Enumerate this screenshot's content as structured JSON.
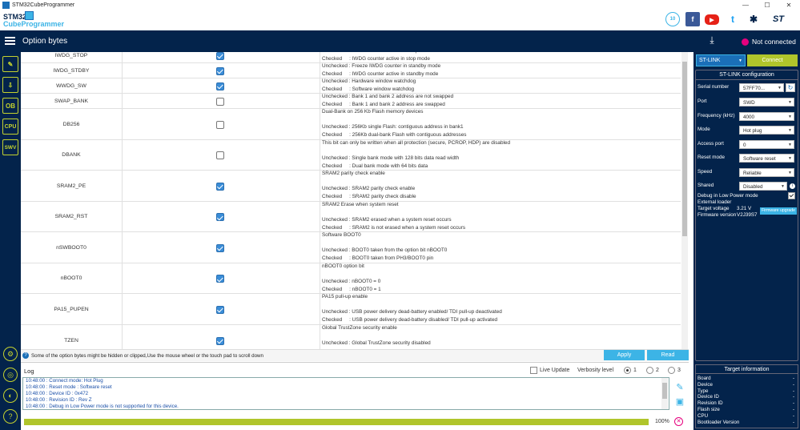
{
  "window": {
    "title": "STM32CubeProgrammer",
    "controls": [
      "—",
      "☐",
      "✕"
    ]
  },
  "logo": {
    "line1": "STM32",
    "line2": "CubeProgrammer"
  },
  "social": [
    "10",
    "f",
    "▶",
    "t",
    "✱",
    "ST"
  ],
  "header": {
    "title": "Option bytes",
    "status": "Not connected"
  },
  "sidebar": {
    "buttons": [
      "✎",
      "⇩",
      "OB",
      "CPU",
      "SWV"
    ],
    "bottom": [
      "⚙",
      "◎",
      "◐",
      "?"
    ]
  },
  "rows": [
    {
      "name": "IWDG_STOP",
      "checked": true,
      "desc": "Unchecked : Freeze IWDG counter in stop mode\nChecked     : IWDG counter active in stop mode"
    },
    {
      "name": "IWDG_STDBY",
      "checked": true,
      "desc": "Unchecked : Freeze IWDG counter in standby mode\nChecked     : IWDG counter active in standby mode"
    },
    {
      "name": "WWDG_SW",
      "checked": true,
      "desc": "Unchecked : Hardware window watchdog\nChecked     : Software window watchdog"
    },
    {
      "name": "SWAP_BANK",
      "checked": false,
      "desc": "Unchecked : Bank 1 and bank 2 address are not swapped\nChecked     : Bank 1 and bank 2 address are swapped"
    },
    {
      "name": "DB256",
      "checked": false,
      "desc": "Dual-Bank on 256 Kb Flash memory devices\n\nUnchecked : 256Kb single Flash: contiguous address in bank1\nChecked     : 256Kb dual-bank Flash with contiguous addresses"
    },
    {
      "name": "DBANK",
      "checked": false,
      "desc": "This bit can only be written when all protection (secure, PCROP, HDP) are disabled\n\nUnchecked : Single bank mode with 128 bits data read width\nChecked     : Dual bank mode with 64 bits data"
    },
    {
      "name": "SRAM2_PE",
      "checked": true,
      "desc": "SRAM2 parity check enable\n\nUnchecked : SRAM2 parity check enable\nChecked     : SRAM2 parity check disable"
    },
    {
      "name": "SRAM2_RST",
      "checked": true,
      "desc": "SRAM2 Erase when system reset\n\nUnchecked : SRAM2 erased when a system reset occurs\nChecked     : SRAM2 is not erased when a system reset occurs"
    },
    {
      "name": "nSWBOOT0",
      "checked": true,
      "desc": "Software BOOT0\n\nUnchecked : BOOT0 taken from the option bit nBOOT0\nChecked     : BOOT0 taken from PH3/BOOT0 pin"
    },
    {
      "name": "nBOOT0",
      "checked": true,
      "desc": "nBOOT0 option bit\n\nUnchecked : nBOOT0 = 0\nChecked     : nBOOT0 = 1"
    },
    {
      "name": "PA15_PUPEN",
      "checked": true,
      "desc": "PA15 pull-up enable\n\nUnchecked : USB power delivery dead-battery enabled/ TDI pull-up deactivated\nChecked     : USB power delivery dead-battery disabled/ TDI pull-up activated"
    },
    {
      "name": "TZEN",
      "checked": true,
      "desc": "Global TrustZone security enable\n\nUnchecked : Global TrustZone security disabled"
    }
  ],
  "info": {
    "text": "Some of the option bytes might be hidden or clipped,Use the mouse wheel or the touch pad to scroll down"
  },
  "actions": {
    "apply": "Apply",
    "read": "Read"
  },
  "log": {
    "title": "Log",
    "live_update": "Live Update",
    "verbosity": "Verbosity level",
    "levels": [
      "1",
      "2",
      "3"
    ],
    "lines": [
      "10:48:00 : Connect mode: Hot Plug",
      "10:48:00 : Reset mode   : Software reset",
      "10:48:00 : Device ID    : 0x472",
      "10:48:00 : Revision ID : Rev Z",
      "10:48:00 : Debug in Low Power mode is not supported for this device."
    ],
    "progress_label": "100%",
    "progress": 1.0
  },
  "probe": {
    "selected": "ST-LINK",
    "connect": "Connect"
  },
  "config": {
    "title": "ST-LINK configuration",
    "serial_label": "Serial number",
    "serial": "57FF70...",
    "fields": [
      {
        "label": "Port",
        "value": "SWD"
      },
      {
        "label": "Frequency (kHz)",
        "value": "4000"
      },
      {
        "label": "Mode",
        "value": "Hot plug"
      },
      {
        "label": "Access port",
        "value": "0"
      },
      {
        "label": "Reset mode",
        "value": "Software reset"
      },
      {
        "label": "Speed",
        "value": "Reliable"
      },
      {
        "label": "Shared",
        "value": "Disabled"
      }
    ],
    "debug_low_power": "Debug in Low Power mode",
    "external_loader": "External loader",
    "target_voltage_label": "Target voltage",
    "target_voltage": "3.21 V",
    "firmware_label": "Firmware version",
    "firmware": "V2J39S7",
    "firmware_upgrade": "Firmware upgrade"
  },
  "target": {
    "title": "Target information",
    "rows": [
      {
        "label": "Board",
        "value": "-"
      },
      {
        "label": "Device",
        "value": "-"
      },
      {
        "label": "Type",
        "value": "-"
      },
      {
        "label": "Device ID",
        "value": "-"
      },
      {
        "label": "Revision ID",
        "value": "-"
      },
      {
        "label": "Flash size",
        "value": "-"
      },
      {
        "label": "CPU",
        "value": "-"
      },
      {
        "label": "Bootloader Version",
        "value": "-"
      }
    ]
  },
  "colors": {
    "navy": "#03234b",
    "accent": "#3cb4e6",
    "lime": "#b0c52b",
    "pink": "#e6007e"
  }
}
